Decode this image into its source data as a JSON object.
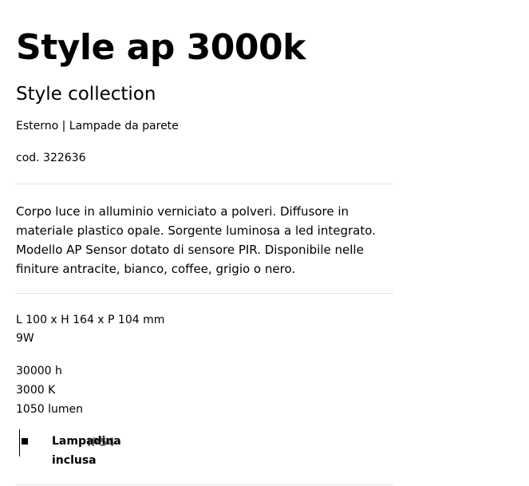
{
  "product": {
    "title": "Style ap 3000k",
    "collection": "Style collection",
    "category": "Esterno | Lampade da parete",
    "code": "cod. 322636",
    "description": "Corpo luce in alluminio verniciato a polveri. Diffusore in materiale plastico opale. Sorgente luminosa a led integrato. Modello AP Sensor dotato di sensore PIR. Disponibile nelle finiture antracite, bianco, coffee, grigio o nero."
  },
  "specs": {
    "dimensions": "L 100 x H 164 x P 104 mm",
    "power": "9W",
    "hours": "30000 h",
    "temperature": "3000 K",
    "lumen": "1050 lumen"
  },
  "feature": {
    "icon": "square-bullet-icon",
    "overlay": "IP54",
    "label": "Lampadina\ninclusa"
  },
  "colors": {
    "text": "#000000",
    "divider": "#e2e2e2",
    "background": "#ffffff"
  }
}
